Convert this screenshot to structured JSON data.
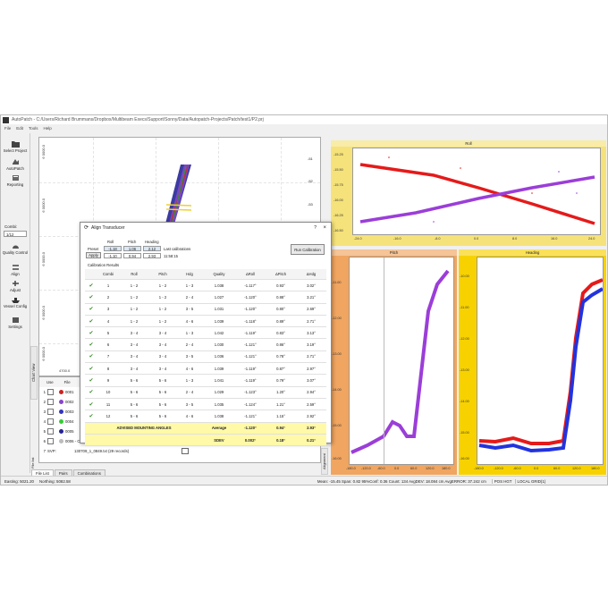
{
  "window": {
    "title": "AutoPatch - C:/Users/Richard Brummans/Dropbox/Multibeam Execs/Support/Sonny/Data/Autopatch-Projects/Patch/test1/P2.prj"
  },
  "menu": [
    "File",
    "Edit",
    "Tools",
    "Help"
  ],
  "toolbar": [
    {
      "label": "Select Project",
      "icon": "folder-icon"
    },
    {
      "label": "AutoPatch",
      "icon": "autopatch-icon"
    },
    {
      "label": "Reporting",
      "icon": "report-icon"
    },
    {
      "label": "Quality Control",
      "icon": "gauge-icon"
    },
    {
      "label": "Align",
      "icon": "align-icon"
    },
    {
      "label": "Adjust",
      "icon": "adjust-icon"
    },
    {
      "label": "Vessel Config",
      "icon": "vessel-icon"
    },
    {
      "label": "Settings",
      "icon": "settings-icon"
    }
  ],
  "combi": {
    "label": "Combi:",
    "value": "1/12"
  },
  "map": {
    "side_tab": "Chart View",
    "y_labels": [
      "6 0000.0",
      "6 0000.0",
      "6 0000.0",
      "6 0000.0",
      "6 0000.0"
    ],
    "x_label": "4700.0",
    "colorbar_labels": [
      "-51",
      "-52",
      "-53"
    ]
  },
  "files": {
    "headers": [
      "Use",
      "File"
    ],
    "rows": [
      {
        "num": "1",
        "color": "#cc2222",
        "name": "0001"
      },
      {
        "num": "2",
        "color": "#8844cc",
        "name": "0002"
      },
      {
        "num": "3",
        "color": "#3333bb",
        "name": "0003"
      },
      {
        "num": "4",
        "color": "#33cc33",
        "name": "0004"
      },
      {
        "num": "5",
        "color": "#222299",
        "name": "0005"
      },
      {
        "num": "6",
        "color": "#bbbbbb",
        "name": "0006 - Calib - 10.all",
        "c3": "16.3",
        "c4": "17.0",
        "c5": "10.0 Hz",
        "c6": "5.0 Hz",
        "c7": "20.0 Hz"
      },
      {
        "num": "7",
        "name": "SVP:",
        "file": "130709_1_0849.txt (29 records)"
      }
    ],
    "tabs": [
      "File List",
      "Pairs",
      "Combinations"
    ],
    "side_label": "File list",
    "alignment_tab": "Alignment"
  },
  "status": {
    "easting": "Easting: 5021.20",
    "northing": "Northing: 5082.58",
    "right": "Mean: -15.45  Span: 0.82  95%Conf: 0.36  Count: 134  AvgDEV: 18.084 cm  AvgERROR: 37.242 cm",
    "mode1": "POS HGT",
    "mode2": "LOCAL GRID(1)"
  },
  "dialog": {
    "title": "Align Transducer",
    "help": "?",
    "close": "×",
    "roll_label": "Roll",
    "pitch_label": "Pitch",
    "heading_label": "Heading",
    "preset_label": "Preset",
    "apply_label": "Apply",
    "preset_roll": "-1.18",
    "preset_pitch": "1.06",
    "preset_heading": "2.12",
    "apply_roll": "-1.10",
    "apply_pitch": "0.94",
    "apply_heading": "2.93",
    "last_cal_label": "Last calibrations",
    "last_cal_time": "11:58:15",
    "run_button": "Run Calibration",
    "results_label": "Calibration Results",
    "headers": [
      "",
      "Combi",
      "Roll",
      "Pitch",
      "Hdg",
      "Quality",
      "ΔRoll",
      "ΔPitch",
      "ΔHdg"
    ],
    "rows": [
      [
        "1",
        "1 - 2",
        "1 - 2",
        "1 - 3",
        "1.038",
        "-1.117°",
        "0.93°",
        "3.02°"
      ],
      [
        "2",
        "1 - 2",
        "1 - 2",
        "2 - 4",
        "1.027",
        "-1.120°",
        "0.88°",
        "3.21°"
      ],
      [
        "3",
        "1 - 2",
        "1 - 2",
        "3 - 5",
        "1.031",
        "-1.120°",
        "0.80°",
        "2.69°"
      ],
      [
        "4",
        "1 - 2",
        "1 - 2",
        "4 - 6",
        "1.039",
        "-1.118°",
        "0.89°",
        "2.71°"
      ],
      [
        "5",
        "3 - 4",
        "3 - 4",
        "1 - 3",
        "1.042",
        "-1.119°",
        "0.83°",
        "3.13°"
      ],
      [
        "6",
        "3 - 4",
        "3 - 4",
        "2 - 4",
        "1.030",
        "-1.121°",
        "0.86°",
        "3.19°"
      ],
      [
        "7",
        "3 - 4",
        "3 - 4",
        "3 - 5",
        "1.036",
        "-1.121°",
        "0.78°",
        "2.71°"
      ],
      [
        "8",
        "3 - 4",
        "3 - 4",
        "4 - 6",
        "1.039",
        "-1.119°",
        "0.87°",
        "2.97°"
      ],
      [
        "9",
        "5 - 6",
        "5 - 6",
        "1 - 3",
        "1.041",
        "-1.119°",
        "0.79°",
        "3.07°"
      ],
      [
        "10",
        "5 - 6",
        "5 - 6",
        "2 - 4",
        "1.029",
        "-1.123°",
        "1.20°",
        "2.94°"
      ],
      [
        "11",
        "5 - 6",
        "5 - 6",
        "3 - 5",
        "1.035",
        "-1.124°",
        "1.21°",
        "2.59°"
      ],
      [
        "12",
        "5 - 6",
        "5 - 6",
        "4 - 6",
        "1.038",
        "-1.121°",
        "1.15°",
        "2.92°"
      ]
    ],
    "advised_label": "ADVISED MOUNTING ANGLES",
    "average_label": "Average",
    "avg_roll": "-1.120°",
    "avg_pitch": "0.94°",
    "avg_hdg": "2.93°",
    "sdev_label": "SDEV",
    "sd_roll": "0.002°",
    "sd_pitch": "0.18°",
    "sd_hdg": "0.21°"
  },
  "charts": {
    "roll": {
      "title": "Roll",
      "bg": "#f5e27a",
      "y_ticks": [
        "-15.25",
        "-15.50",
        "-15.75",
        "-16.00",
        "-16.25",
        "-16.50"
      ],
      "x_ticks": [
        "-24.0",
        "-16.0",
        "-8.0",
        "0.0",
        "8.0",
        "16.0",
        "24.0"
      ]
    },
    "pitch": {
      "title": "Pitch",
      "bg": "#f0a560",
      "y_ticks": [
        "-11.00",
        "-12.00",
        "-13.00",
        "-14.00",
        "-15.00",
        "-16.00"
      ],
      "x_ticks": [
        "-180.0",
        "-120.0",
        "-60.0",
        "0.0",
        "60.0",
        "120.0",
        "180.0"
      ]
    },
    "heading": {
      "title": "Heading",
      "bg": "#f7d200",
      "y_ticks": [
        "-10.00",
        "-11.00",
        "-12.00",
        "-13.00",
        "-14.00",
        "-15.00",
        "-16.00"
      ],
      "x_ticks": [
        "-180.0",
        "-120.0",
        "-60.0",
        "0.0",
        "60.0",
        "120.0",
        "180.0"
      ]
    }
  }
}
